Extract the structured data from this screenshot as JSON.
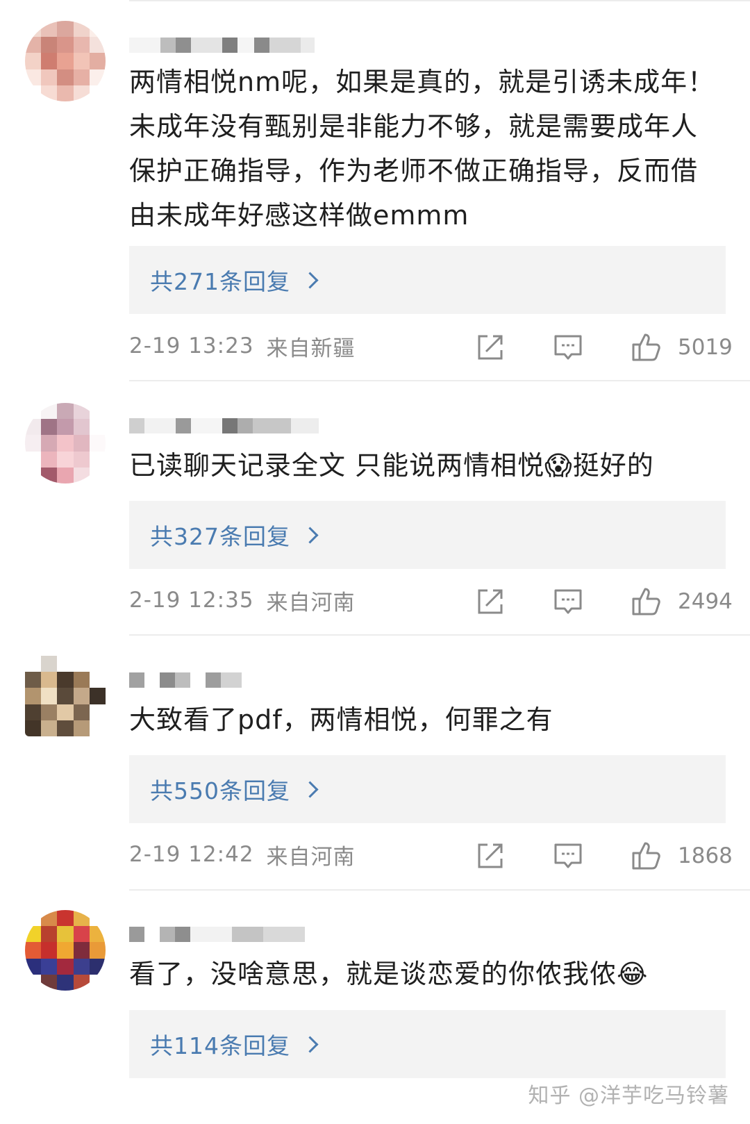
{
  "comments": [
    {
      "text": "两情相悦nm呢，如果是真的，就是引诱未成年！未成年没有甄别是非能力不够，就是需要成年人保护正确指导，作为老师不做正确指导，反而借由未成年好感这样做emmm",
      "reply_label": "共271条回复",
      "time": "2-19 13:23",
      "location": "来自新疆",
      "likes": "5019"
    },
    {
      "text": "已读聊天记录全文 只能说两情相悦😱挺好的",
      "reply_label": "共327条回复",
      "time": "2-19 12:35",
      "location": "来自河南",
      "likes": "2494"
    },
    {
      "text": "大致看了pdf，两情相悦，何罪之有",
      "reply_label": "共550条回复",
      "time": "2-19 12:42",
      "location": "来自河南",
      "likes": "1868"
    },
    {
      "text": "看了，没啥意思，就是谈恋爱的你侬我侬😂",
      "reply_label": "共114条回复"
    }
  ],
  "watermark": "知乎 @洋芋吃马铃薯",
  "icons": {
    "share": "share-icon",
    "reply": "comment-icon",
    "like": "thumbs-up-icon",
    "more": "chevron-right-icon"
  },
  "colors": {
    "link": "#4a7bb0",
    "meta": "#8a8a8a",
    "reply_bg": "#f3f3f3"
  }
}
